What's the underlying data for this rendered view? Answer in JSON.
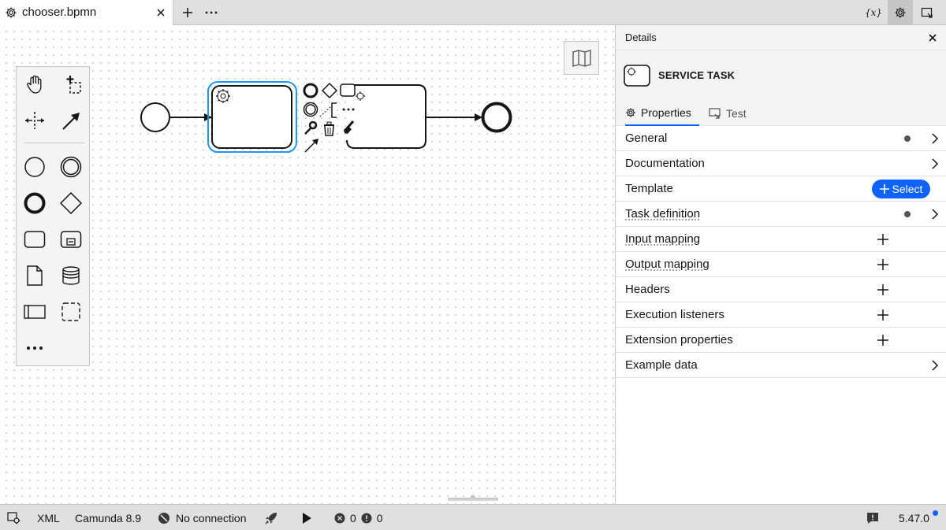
{
  "tabs": [
    {
      "label": "chooser.bpmn",
      "icon": "gear-icon"
    }
  ],
  "tabbar": {
    "add_icon": "plus-icon",
    "more_icon": "overflow-menu-icon",
    "variables_label": "{x}",
    "settings_icon": "gear-icon",
    "panel_toggle_icon": "panel-icon"
  },
  "palette": {
    "tools": [
      "hand-tool",
      "lasso-tool",
      "space-tool",
      "global-connect-tool",
      "start-event",
      "intermediate-event",
      "end-event",
      "gateway",
      "task",
      "subprocess",
      "data-object",
      "data-store",
      "pool",
      "group",
      "more-tools"
    ]
  },
  "diagram": {
    "selected_task_type": "service-task",
    "context_pad": [
      "end-event",
      "gateway",
      "task",
      "intermediate-event",
      "text-annotation",
      "more",
      "change-type",
      "delete",
      "color",
      "connect"
    ]
  },
  "details": {
    "title": "Details",
    "element_type": "SERVICE TASK",
    "tabs": [
      {
        "label": "Properties",
        "active": true
      },
      {
        "label": "Test",
        "active": false
      }
    ],
    "groups": [
      {
        "label": "General",
        "indicator": true,
        "action": "chevron",
        "dotted": false
      },
      {
        "label": "Documentation",
        "indicator": false,
        "action": "chevron",
        "dotted": false
      },
      {
        "label": "Template",
        "indicator": false,
        "action": "select",
        "dotted": false
      },
      {
        "label": "Task definition",
        "indicator": true,
        "action": "chevron",
        "dotted": true
      },
      {
        "label": "Input mapping",
        "indicator": false,
        "action": "plus",
        "dotted": true
      },
      {
        "label": "Output mapping",
        "indicator": false,
        "action": "plus",
        "dotted": true
      },
      {
        "label": "Headers",
        "indicator": false,
        "action": "plus",
        "dotted": false
      },
      {
        "label": "Execution listeners",
        "indicator": false,
        "action": "plus",
        "dotted": false
      },
      {
        "label": "Extension properties",
        "indicator": false,
        "action": "plus",
        "dotted": false
      },
      {
        "label": "Example data",
        "indicator": false,
        "action": "chevron",
        "dotted": false
      }
    ],
    "select_label": "Select"
  },
  "statusbar": {
    "format": "XML",
    "engine": "Camunda 8.9",
    "connection": "No connection",
    "errors": "0",
    "warnings": "0",
    "version": "5.47.0"
  },
  "colors": {
    "accent": "#0f62fe",
    "selection": "#2196f3",
    "chrome": "#e0e0e0",
    "panel_bg": "#f4f4f4"
  }
}
